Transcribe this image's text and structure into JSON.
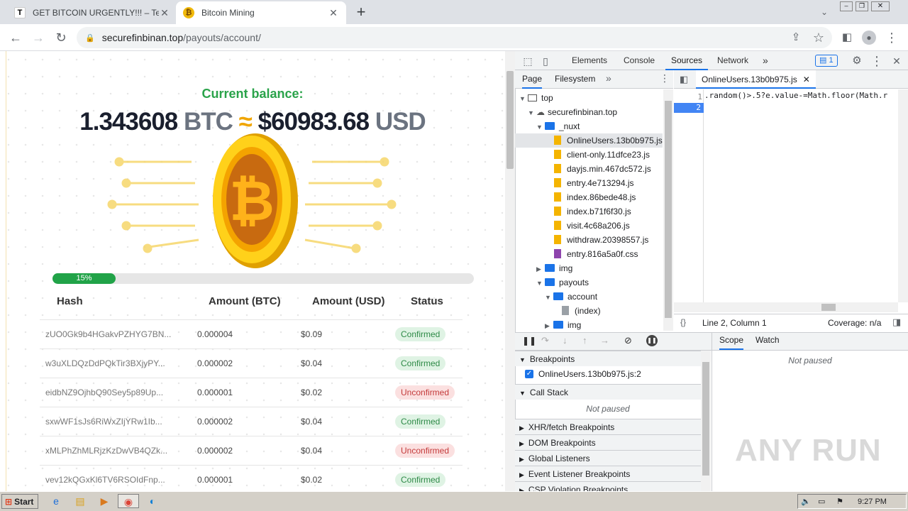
{
  "browser": {
    "tabs": [
      {
        "favicon": "T",
        "title": "GET BITCOIN URGENTLY!!! – Telegra",
        "close": "✕"
      },
      {
        "favicon": "₿",
        "title": "Bitcoin Mining",
        "close": "✕"
      }
    ],
    "new_tab": "+",
    "url_host": "securefinbinan.top",
    "url_path": "/payouts/account/"
  },
  "page": {
    "balance_label": "Current balance:",
    "btc_amount": "1.343608",
    "btc_unit": "BTC",
    "approx": "≈",
    "usd_amount": "$60983.68",
    "usd_unit": "USD",
    "progress": {
      "value_percent": 15,
      "label": "15%"
    },
    "table": {
      "headers": [
        "Hash",
        "Amount (BTC)",
        "Amount (USD)",
        "Status"
      ],
      "rows": [
        {
          "hash": "zUO0Gk9b4HGakvPZHYG7BN...",
          "btc": "0.000004",
          "usd": "$0.09",
          "status": "Confirmed",
          "ok": true
        },
        {
          "hash": "w3uXLDQzDdPQkTir3BXjyPY...",
          "btc": "0.000002",
          "usd": "$0.04",
          "status": "Confirmed",
          "ok": true
        },
        {
          "hash": "eidbNZ9OjhbQ90Sey5p89Up...",
          "btc": "0.000001",
          "usd": "$0.02",
          "status": "Unconfirmed",
          "ok": false
        },
        {
          "hash": "sxwWF1sJs6RiWxZIjYRw1Ib...",
          "btc": "0.000002",
          "usd": "$0.04",
          "status": "Confirmed",
          "ok": true
        },
        {
          "hash": "xMLPhZhMLRjzKzDwVB4QZk...",
          "btc": "0.000002",
          "usd": "$0.04",
          "status": "Unconfirmed",
          "ok": false
        },
        {
          "hash": "vev12kQGxKl6TV6RSOIdFnp...",
          "btc": "0.000001",
          "usd": "$0.02",
          "status": "Confirmed",
          "ok": true
        }
      ]
    }
  },
  "devtools": {
    "tabs": [
      "Elements",
      "Console",
      "Sources",
      "Network"
    ],
    "more": "»",
    "issues_count": "1",
    "navigator_tabs": [
      "Page",
      "Filesystem"
    ],
    "tree": {
      "top": "top",
      "domain": "securefinbinan.top",
      "nuxt": "_nuxt",
      "files": [
        "OnlineUsers.13b0b975.js",
        "client-only.11dfce23.js",
        "dayjs.min.467dc572.js",
        "entry.4e713294.js",
        "index.86bede48.js",
        "index.b71f6f30.js",
        "visit.4c68a206.js",
        "withdraw.20398557.js",
        "entry.816a5a0f.css"
      ],
      "img": "img",
      "payouts": "payouts",
      "account": "account",
      "index": "(index)",
      "img2": "img"
    },
    "editor_tab": "OnlineUsers.13b0b975.js",
    "code_line1": ".random()>.5?e.value-=Math.floor(Math.r",
    "line_numbers": [
      "1",
      "2"
    ],
    "status_position": "Line 2, Column 1",
    "coverage": "Coverage: n/a",
    "breakpoints_header": "Breakpoints",
    "breakpoint_item": "OnlineUsers.13b0b975.js:2",
    "callstack_header": "Call Stack",
    "not_paused": "Not paused",
    "sections": [
      "XHR/fetch Breakpoints",
      "DOM Breakpoints",
      "Global Listeners",
      "Event Listener Breakpoints",
      "CSP Violation Breakpoints"
    ],
    "scope_tabs": [
      "Scope",
      "Watch"
    ]
  },
  "watermark": "ANY RUN",
  "taskbar": {
    "start": "Start",
    "time": "9:27 PM"
  }
}
